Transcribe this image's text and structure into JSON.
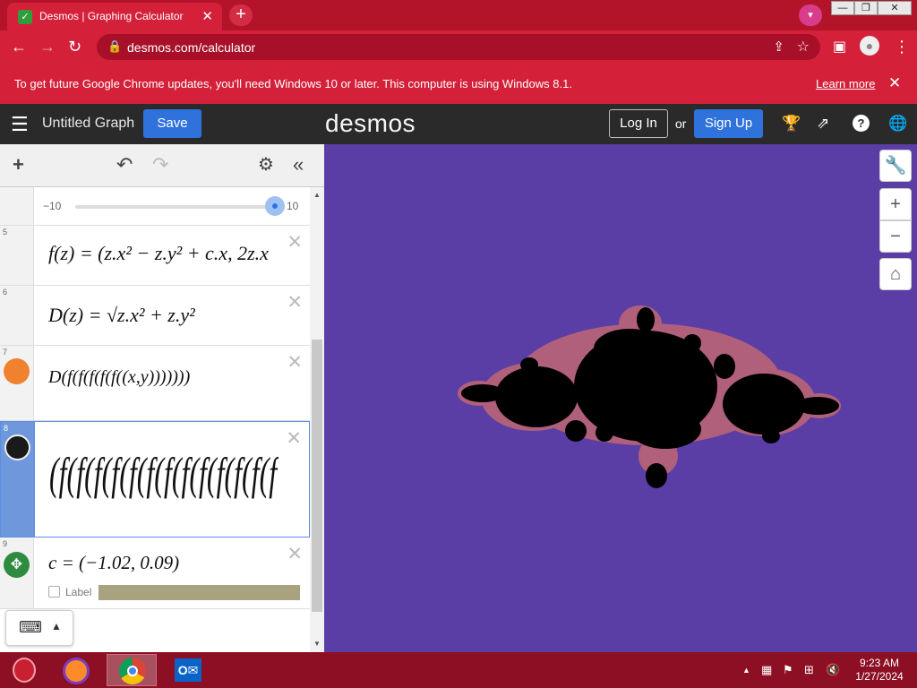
{
  "browser": {
    "tab_title": "Desmos | Graphing Calculator",
    "url": "desmos.com/calculator",
    "infobar_message": "To get future Google Chrome updates, you'll need Windows 10 or later. This computer is using Windows 8.1.",
    "infobar_link": "Learn more"
  },
  "header": {
    "graph_title": "Untitled Graph",
    "save_label": "Save",
    "logo": "desmos",
    "login_label": "Log In",
    "or_label": "or",
    "signup_label": "Sign Up"
  },
  "expressions": {
    "slider": {
      "min": "−10",
      "max": "10",
      "value_fraction": 1.0
    },
    "e5": {
      "num": "5"
    },
    "e6": {
      "num": "6"
    },
    "e7": {
      "num": "7",
      "color": "#f0812f"
    },
    "e8": {
      "num": "8",
      "color": "#1a1a1a"
    },
    "e9": {
      "num": "9",
      "color": "#2d8c3f",
      "label_text": "Label"
    }
  },
  "colors": {
    "graph_bg": "#5b3ea5",
    "fractal_halo": "#b0607a",
    "fractal_body": "#000000",
    "accent": "#2f72dc",
    "chrome_red": "#d42039"
  },
  "taskbar": {
    "time": "9:23 AM",
    "date": "1/27/2024"
  }
}
